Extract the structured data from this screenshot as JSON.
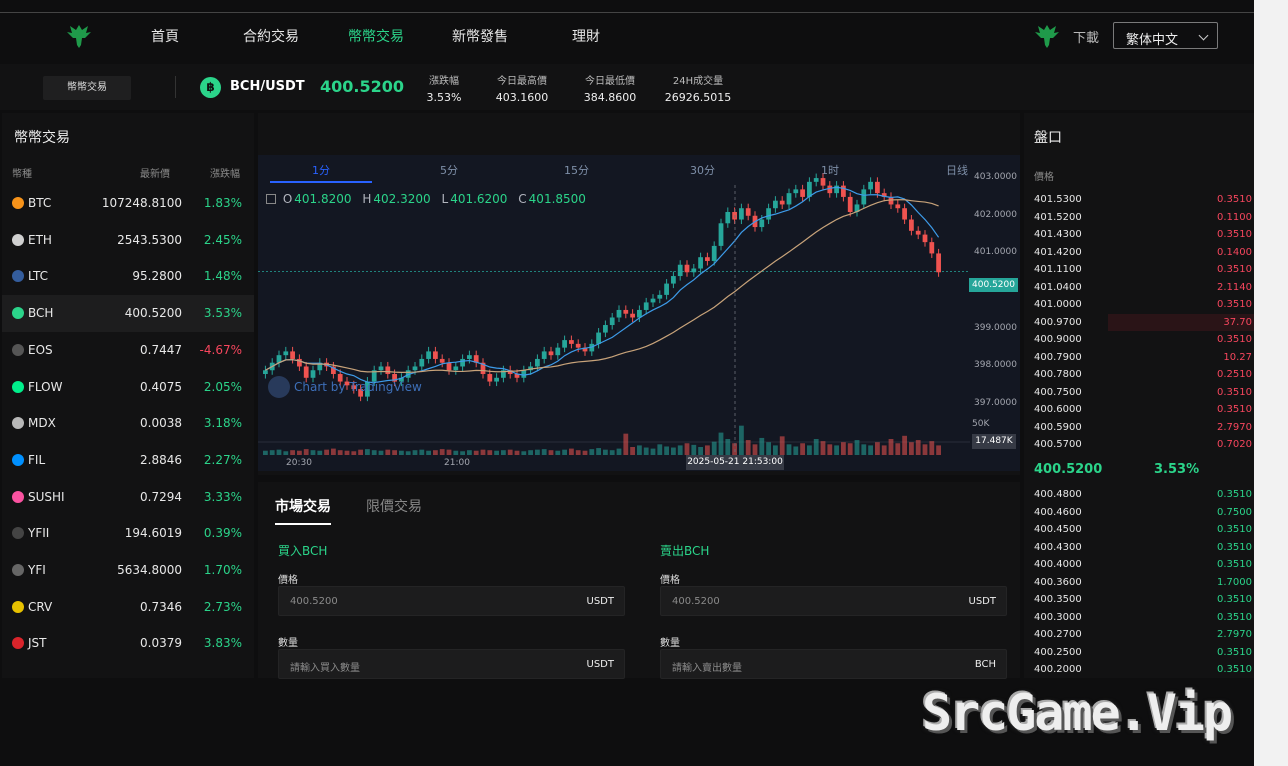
{
  "nav": {
    "items": [
      "首頁",
      "合約交易",
      "幣幣交易",
      "新幣發售",
      "理財"
    ],
    "active": "幣幣交易",
    "download_label": "下載",
    "language": "繁体中文"
  },
  "ticker": {
    "pair_button": "幣幣交易",
    "pair": "BCH/USDT",
    "coin_symbol": "฿",
    "price": "400.5200",
    "stats": [
      {
        "label": "漲跌幅",
        "value": "3.53%"
      },
      {
        "label": "今日最高價",
        "value": "403.1600"
      },
      {
        "label": "今日最低價",
        "value": "384.8600"
      },
      {
        "label": "24H成交量",
        "value": "26926.5015"
      }
    ]
  },
  "market": {
    "title": "幣幣交易",
    "headers": [
      "幣種",
      "最新價",
      "漲跌幅"
    ],
    "rows": [
      {
        "symbol": "BTC",
        "price": "107248.8100",
        "change": "1.83%",
        "dir": "up",
        "icon": "btc-icon",
        "color": "#f7931a"
      },
      {
        "symbol": "ETH",
        "price": "2543.5300",
        "change": "2.45%",
        "dir": "up",
        "icon": "eth-icon",
        "color": "#d0d0d0"
      },
      {
        "symbol": "LTC",
        "price": "95.2800",
        "change": "1.48%",
        "dir": "up",
        "icon": "ltc-icon",
        "color": "#345d9d"
      },
      {
        "symbol": "BCH",
        "price": "400.5200",
        "change": "3.53%",
        "dir": "up",
        "icon": "bch-icon",
        "color": "#2bd48a"
      },
      {
        "symbol": "EOS",
        "price": "0.7447",
        "change": "-4.67%",
        "dir": "down",
        "icon": "eos-icon",
        "color": "#555555"
      },
      {
        "symbol": "FLOW",
        "price": "0.4075",
        "change": "2.05%",
        "dir": "up",
        "icon": "flow-icon",
        "color": "#00ef8b"
      },
      {
        "symbol": "MDX",
        "price": "0.0038",
        "change": "3.18%",
        "dir": "up",
        "icon": "mdx-icon",
        "color": "#b8b8b8"
      },
      {
        "symbol": "FIL",
        "price": "2.8846",
        "change": "2.27%",
        "dir": "up",
        "icon": "fil-icon",
        "color": "#0090ff"
      },
      {
        "symbol": "SUSHI",
        "price": "0.7294",
        "change": "3.33%",
        "dir": "up",
        "icon": "sushi-icon",
        "color": "#fa52a0"
      },
      {
        "symbol": "YFII",
        "price": "194.6019",
        "change": "0.39%",
        "dir": "up",
        "icon": "yfii-icon",
        "color": "#444444"
      },
      {
        "symbol": "YFI",
        "price": "5634.8000",
        "change": "1.70%",
        "dir": "up",
        "icon": "yfi-icon",
        "color": "#666666"
      },
      {
        "symbol": "CRV",
        "price": "0.7346",
        "change": "2.73%",
        "dir": "up",
        "icon": "crv-icon",
        "color": "#e7c100"
      },
      {
        "symbol": "JST",
        "price": "0.0379",
        "change": "3.83%",
        "dir": "up",
        "icon": "jst-icon",
        "color": "#d9242b"
      }
    ]
  },
  "chart": {
    "timeframes": [
      "1分",
      "5分",
      "15分",
      "30分",
      "1时",
      "日线"
    ],
    "active_timeframe": "1分",
    "ohlc": {
      "o": "401.8200",
      "h": "402.3200",
      "l": "401.6200",
      "c": "401.8500"
    },
    "price_axis": [
      "403.0000",
      "402.0000",
      "401.0000",
      "400.0000",
      "399.0000",
      "398.0000",
      "397.0000"
    ],
    "last_price_tag": "400.5200",
    "volume_axis_label": "50K",
    "volume_tag": "17.487K",
    "time_axis": [
      "20:30",
      "21:00"
    ],
    "crosshair_time": "2025-05-21 21:53:00",
    "watermark": "Chart by TradingView",
    "colors": {
      "up": "#26a69a",
      "down": "#ef5350",
      "ma_fast": "#3d9be9",
      "ma_slow": "#c8a37a"
    }
  },
  "chart_data": {
    "type": "candlestick",
    "price_range": [
      396.5,
      403.4
    ],
    "volume_axis_tick": 50000,
    "candles_close": [
      397.9,
      398.1,
      398.3,
      398.4,
      398.2,
      398.0,
      397.7,
      397.9,
      398.1,
      398.0,
      397.8,
      397.6,
      397.5,
      397.4,
      397.2,
      397.6,
      397.9,
      398.0,
      397.8,
      397.6,
      397.7,
      397.9,
      398.0,
      398.2,
      398.4,
      398.2,
      398.1,
      397.9,
      398.0,
      398.2,
      398.3,
      398.1,
      397.8,
      397.6,
      397.7,
      397.9,
      397.8,
      397.7,
      397.9,
      398.0,
      398.2,
      398.4,
      398.3,
      398.5,
      398.7,
      398.6,
      398.5,
      398.4,
      398.6,
      398.9,
      399.1,
      399.3,
      399.5,
      399.4,
      399.3,
      399.5,
      399.7,
      399.8,
      399.9,
      400.2,
      400.4,
      400.7,
      400.5,
      400.6,
      400.9,
      400.8,
      401.2,
      401.8,
      402.1,
      401.9,
      402.2,
      402.0,
      401.7,
      401.9,
      402.2,
      402.4,
      402.3,
      402.6,
      402.7,
      402.5,
      402.9,
      403.0,
      402.8,
      402.6,
      402.8,
      402.5,
      402.1,
      402.3,
      402.7,
      402.9,
      402.6,
      402.5,
      402.3,
      402.2,
      401.9,
      401.6,
      401.5,
      401.3,
      401.0,
      400.5
    ],
    "volumes": [
      8,
      9,
      10,
      7,
      9,
      8,
      11,
      9,
      8,
      10,
      12,
      9,
      8,
      7,
      10,
      11,
      9,
      8,
      10,
      9,
      8,
      7,
      9,
      10,
      8,
      9,
      11,
      10,
      8,
      7,
      9,
      8,
      10,
      9,
      8,
      9,
      10,
      8,
      7,
      9,
      10,
      11,
      9,
      8,
      10,
      12,
      9,
      8,
      11,
      13,
      10,
      9,
      12,
      40,
      15,
      18,
      14,
      12,
      20,
      16,
      14,
      18,
      22,
      19,
      15,
      18,
      25,
      42,
      30,
      22,
      55,
      28,
      20,
      32,
      24,
      18,
      35,
      20,
      16,
      22,
      18,
      30,
      26,
      20,
      18,
      24,
      22,
      28,
      20,
      18,
      24,
      18,
      30,
      22,
      36,
      24,
      28,
      20,
      26,
      18
    ]
  },
  "trade": {
    "tabs": [
      "市場交易",
      "限價交易"
    ],
    "buy": {
      "title": "買入BCH",
      "price_label": "價格",
      "price_value": "400.5200",
      "price_unit": "USDT",
      "qty_label": "數量",
      "qty_placeholder": "請輸入買入數量",
      "qty_unit": "USDT"
    },
    "sell": {
      "title": "賣出BCH",
      "price_label": "價格",
      "price_value": "400.5200",
      "price_unit": "USDT",
      "qty_label": "數量",
      "qty_placeholder": "請輸入賣出數量",
      "qty_unit": "BCH"
    }
  },
  "book": {
    "title": "盤口",
    "header": "價格",
    "asks": [
      {
        "price": "401.5300",
        "amount": "0.3510"
      },
      {
        "price": "401.5200",
        "amount": "0.1100"
      },
      {
        "price": "401.4300",
        "amount": "0.3510"
      },
      {
        "price": "401.4200",
        "amount": "0.1400"
      },
      {
        "price": "401.1100",
        "amount": "0.3510"
      },
      {
        "price": "401.0400",
        "amount": "2.1140"
      },
      {
        "price": "401.0000",
        "amount": "0.3510"
      },
      {
        "price": "400.9700",
        "amount": "37.70"
      },
      {
        "price": "400.9000",
        "amount": "0.3510"
      },
      {
        "price": "400.7900",
        "amount": "10.27"
      },
      {
        "price": "400.7800",
        "amount": "0.2510"
      },
      {
        "price": "400.7500",
        "amount": "0.3510"
      },
      {
        "price": "400.6000",
        "amount": "0.3510"
      },
      {
        "price": "400.5900",
        "amount": "2.7970"
      },
      {
        "price": "400.5700",
        "amount": "0.7020"
      }
    ],
    "mid_price": "400.5200",
    "mid_change": "3.53%",
    "bids": [
      {
        "price": "400.4800",
        "amount": "0.3510"
      },
      {
        "price": "400.4600",
        "amount": "0.7500"
      },
      {
        "price": "400.4500",
        "amount": "0.3510"
      },
      {
        "price": "400.4300",
        "amount": "0.3510"
      },
      {
        "price": "400.4000",
        "amount": "0.3510"
      },
      {
        "price": "400.3600",
        "amount": "1.7000"
      },
      {
        "price": "400.3500",
        "amount": "0.3510"
      },
      {
        "price": "400.3000",
        "amount": "0.3510"
      },
      {
        "price": "400.2700",
        "amount": "2.7970"
      },
      {
        "price": "400.2500",
        "amount": "0.3510"
      },
      {
        "price": "400.2000",
        "amount": "0.3510"
      }
    ]
  },
  "watermark": "SrcGame.Vip"
}
